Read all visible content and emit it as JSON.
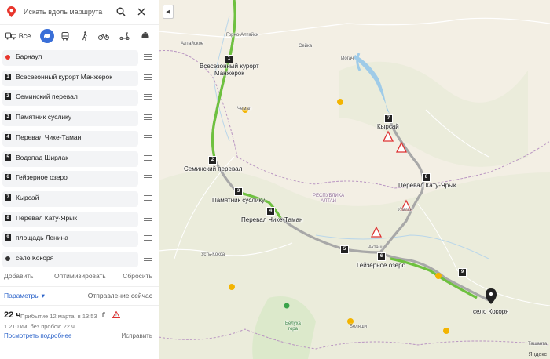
{
  "search": {
    "placeholder": "Искать вдоль маршрута"
  },
  "modes": {
    "all_label": "Все"
  },
  "stops": [
    {
      "label": "Барнаул",
      "kind": "start",
      "color": "#e8362d"
    },
    {
      "label": "Всесезонный курорт Манжерок",
      "num": "1"
    },
    {
      "label": "Семинский перевал",
      "num": "2"
    },
    {
      "label": "Памятник суслику",
      "num": "3"
    },
    {
      "label": "Перевал Чике-Таман",
      "num": "4"
    },
    {
      "label": "Водопад Ширлак",
      "num": "5"
    },
    {
      "label": "Гейзерное озеро",
      "num": "6"
    },
    {
      "label": "Кырсай",
      "num": "7"
    },
    {
      "label": "Перевал Кату-Ярык",
      "num": "8"
    },
    {
      "label": "площадь Ленина",
      "num": "9"
    },
    {
      "label": "село Кокоря",
      "kind": "end",
      "color": "#333333"
    }
  ],
  "actions": {
    "add": "Добавить",
    "optimize": "Оптимизировать",
    "reset": "Сбросить"
  },
  "params": {
    "label": "Параметры ▾",
    "mode": "Отправление сейчас"
  },
  "result": {
    "duration": "22 ч",
    "arrival": "Прибытие 12 марта, в 13:53",
    "distance": "1 210 км, без пробок: 22 ч",
    "details": "Посмотреть подробнее",
    "fix": "Исправить"
  },
  "map": {
    "labels": {
      "manzherok": "Всесезонный курорт\nМанжерок",
      "seminsky": "Семинский перевал",
      "suslik": "Памятник суслику",
      "chike": "Перевал Чике-Таман",
      "geyser": "Гейзерное озеро",
      "kyrsay": "Кырсай",
      "katu": "Перевал Кату-Ярык",
      "kokorya": "село Кокоря",
      "altaiskoe": "Алтайское",
      "gorno": "Горно-Алтайск",
      "seyka": "Сейка",
      "iogach": "Иогач",
      "chemal": "Чемал",
      "ust_koksa": "Усть-Кокса",
      "respublika": "РЕСПУБЛИКА\nАЛТАЙ",
      "ulagan": "Улаган",
      "aktash": "Акташ",
      "belyashi": "Беляши",
      "belukha": "Белуха\nгора",
      "tashanta": "Ташанта",
      "yandex": "Яндекс"
    },
    "waypoints": [
      "1",
      "2",
      "3",
      "4",
      "5",
      "6",
      "7",
      "8",
      "9"
    ],
    "route_color": "#6ec13f"
  }
}
